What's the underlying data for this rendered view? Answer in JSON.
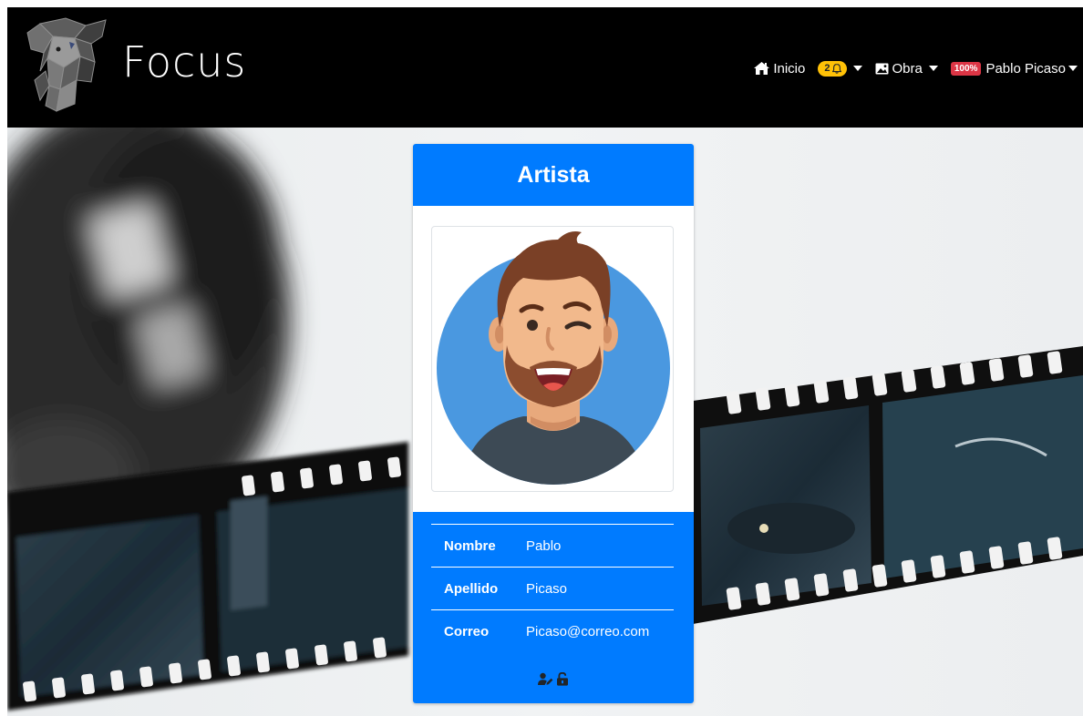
{
  "brand": {
    "name": "Focus",
    "logo_icon": "elephant-logo-icon"
  },
  "nav": {
    "home_label": "Inicio",
    "home_icon": "home-icon",
    "notifications_count": "2",
    "notifications_icon": "bell-icon",
    "obra_label": "Obra",
    "obra_icon": "image-icon",
    "profile_badge": "100%",
    "user_name": "Pablo Picaso"
  },
  "card": {
    "title": "Artista",
    "avatar_icon": "avatar-illustration",
    "fields": [
      {
        "label": "Nombre",
        "value": "Pablo"
      },
      {
        "label": "Apellido",
        "value": "Picaso"
      },
      {
        "label": "Correo",
        "value": "Picaso@correo.com"
      }
    ],
    "actions": [
      {
        "icon": "user-edit-icon"
      },
      {
        "icon": "unlock-icon"
      }
    ]
  },
  "colors": {
    "navbar": "#000000",
    "primary": "#007bff",
    "warning_badge": "#ffc107",
    "danger_badge": "#dc3545"
  }
}
